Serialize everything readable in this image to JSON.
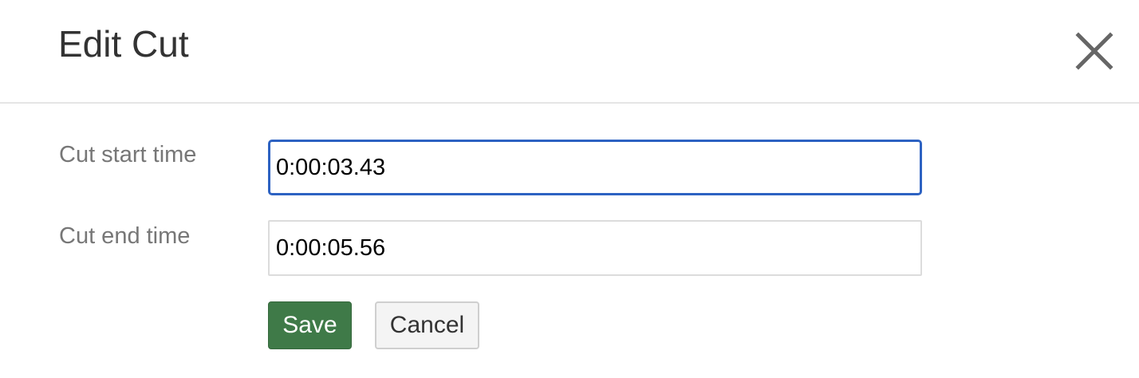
{
  "dialog": {
    "title": "Edit Cut",
    "close_icon": "close-x-icon"
  },
  "form": {
    "start": {
      "label": "Cut start time",
      "value": "0:00:03.43"
    },
    "end": {
      "label": "Cut end time",
      "value": "0:00:05.56"
    }
  },
  "buttons": {
    "save_label": "Save",
    "cancel_label": "Cancel"
  },
  "colors": {
    "save_background": "#3f7a48",
    "focus_border": "#2d62c2"
  }
}
